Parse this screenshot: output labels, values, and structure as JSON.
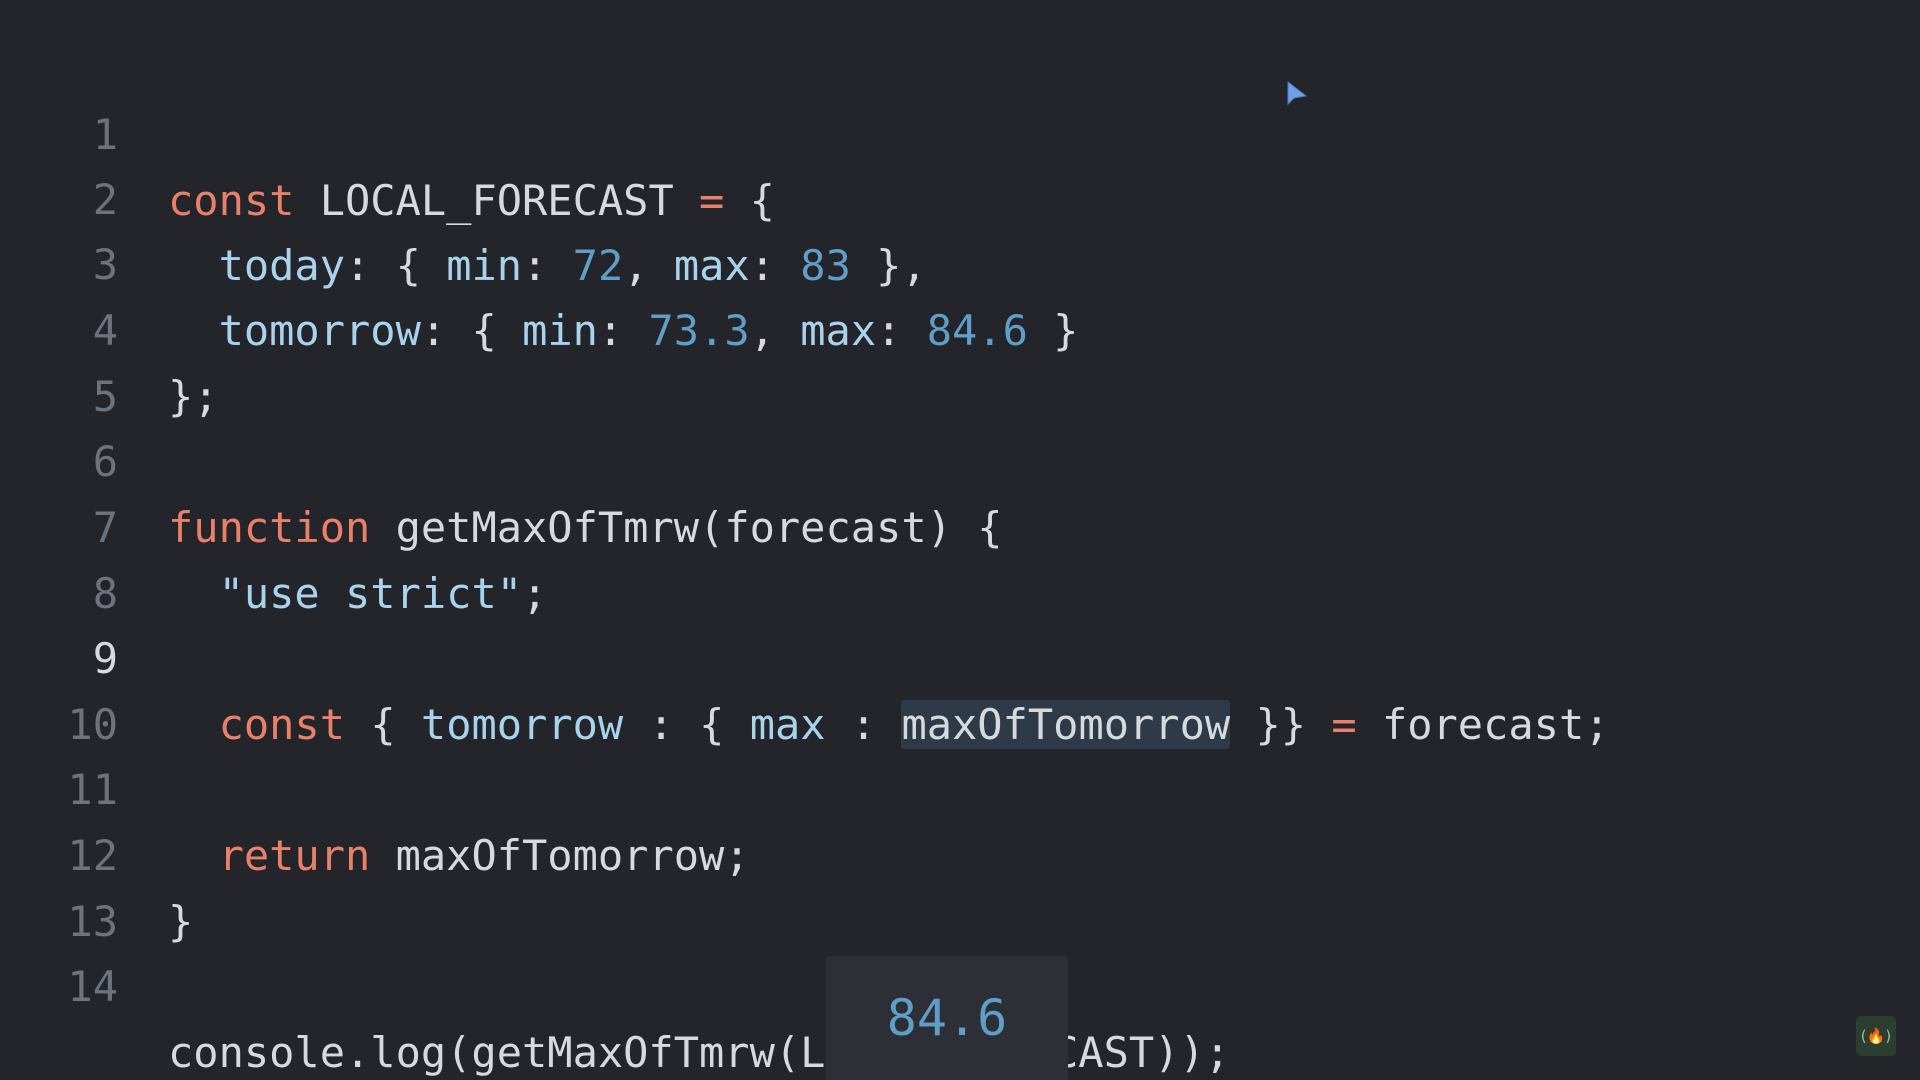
{
  "editor": {
    "line_numbers": [
      "1",
      "2",
      "3",
      "4",
      "5",
      "6",
      "7",
      "8",
      "9",
      "10",
      "11",
      "12",
      "13",
      "14"
    ],
    "active_line": "9",
    "lines": {
      "l1": {
        "kw": "const",
        "name": "LOCAL_FORECAST",
        "op": "=",
        "brace": "{"
      },
      "l2": {
        "key": "today",
        "colon1": ":",
        "open": "{",
        "k1": "min",
        "c1": ":",
        "v1": "72",
        "sep": ",",
        "k2": "max",
        "c2": ":",
        "v2": "83",
        "close": "},"
      },
      "l3": {
        "key": "tomorrow",
        "colon1": ":",
        "open": "{",
        "k1": "min",
        "c1": ":",
        "v1": "73.3",
        "sep": ",",
        "k2": "max",
        "c2": ":",
        "v2": "84.6",
        "close": "}"
      },
      "l4": {
        "text": "};"
      },
      "l6": {
        "kw": "function",
        "fn": "getMaxOfTmrw",
        "params": "(forecast)",
        "brace": "{"
      },
      "l7": {
        "str": "\"use strict\"",
        "semi": ";"
      },
      "l9": {
        "kw": "const",
        "open": "{",
        "k1": "tomorrow",
        "c1": ":",
        "open2": "{",
        "k2": "max",
        "c2": ":",
        "alias": "maxOfTomorrow",
        "close": "}}",
        "op": "=",
        "rhs": "forecast;"
      },
      "l11": {
        "kw": "return",
        "value": "maxOfTomorrow;"
      },
      "l12": {
        "text": "}"
      },
      "l14": {
        "text": "console.log(getMaxOfTmrw(LOCAL_FORECAST));"
      }
    }
  },
  "console": {
    "output": "84.6"
  },
  "icons": {
    "cursor": "mouse-pointer-icon",
    "badge": "freecodecamp-logo-icon",
    "badge_glyph": "(🔥)"
  },
  "colors": {
    "background": "#23252b",
    "keyword": "#e8806a",
    "number": "#5e9ec7",
    "property": "#a9d2ec",
    "text": "#d6d9dd",
    "line_number": "#6d737c"
  }
}
